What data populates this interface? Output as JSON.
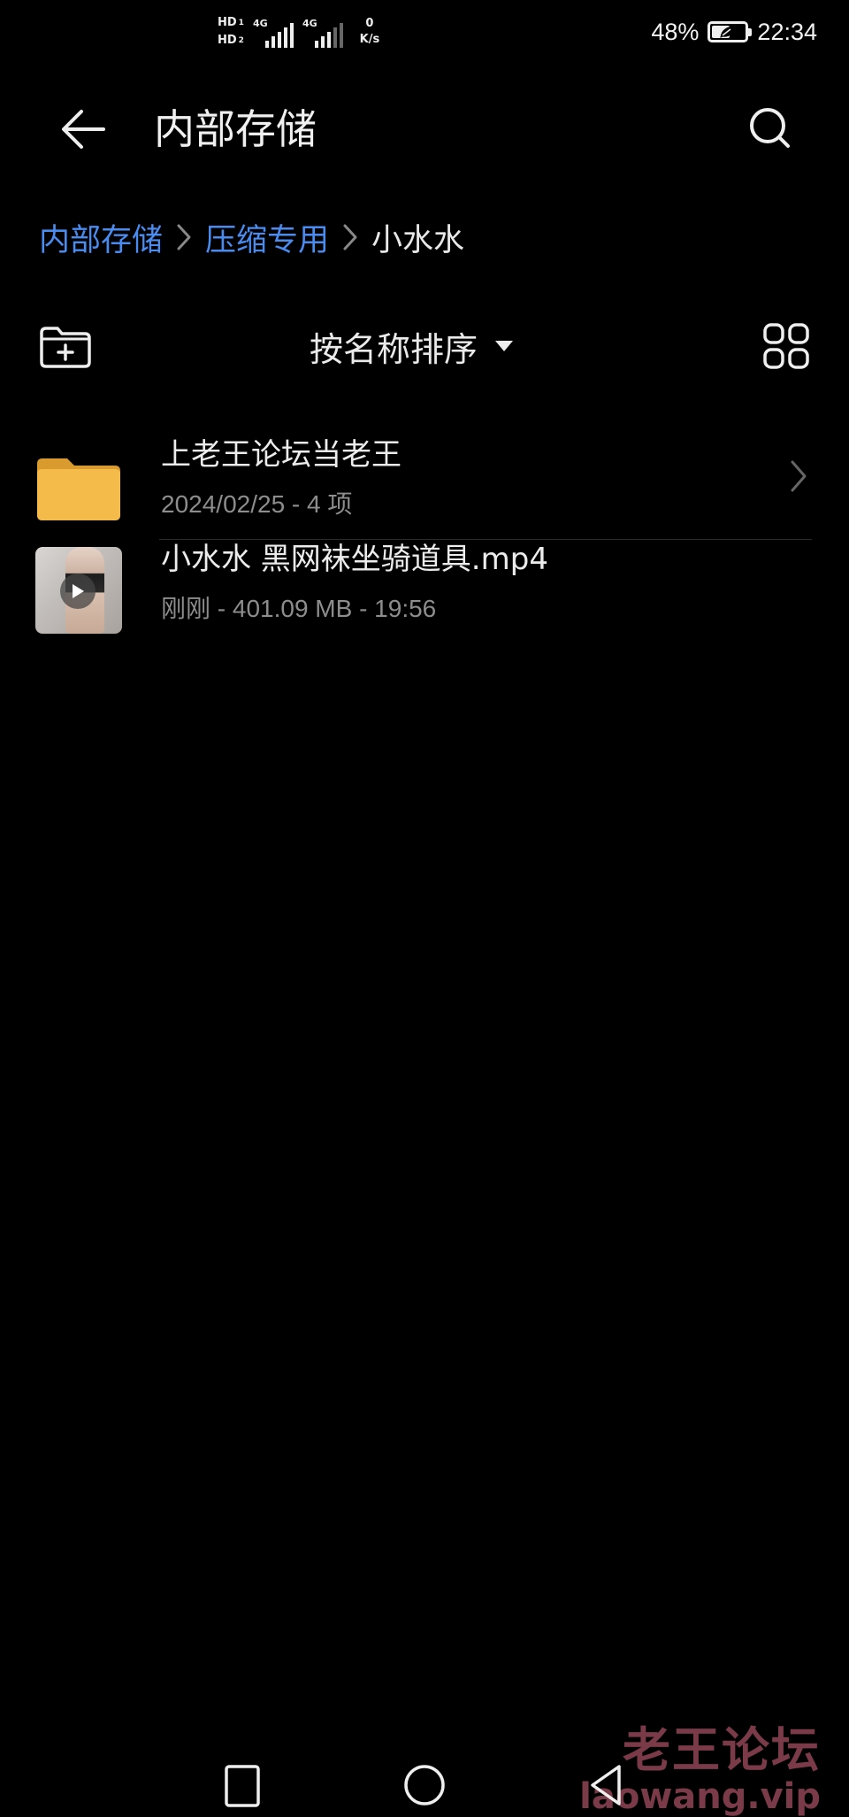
{
  "status_bar": {
    "hd1": "HD",
    "hd1_sub": "1",
    "hd2": "HD",
    "hd2_sub": "2",
    "sim1_network": "4G",
    "sim2_network": "4G",
    "speed_value": "0",
    "speed_unit": "K/s",
    "battery_percent": "48%",
    "battery_level": 0.48,
    "time": "22:34"
  },
  "header": {
    "title": "内部存储",
    "back_icon": "arrow-left-icon",
    "search_icon": "search-icon"
  },
  "breadcrumb": {
    "items": [
      {
        "label": "内部存储",
        "link": true
      },
      {
        "label": "压缩专用",
        "link": true
      },
      {
        "label": "小水水",
        "link": false
      }
    ],
    "link_color": "#4a8bf0"
  },
  "toolbar": {
    "new_folder_icon": "folder-plus-icon",
    "sort_label": "按名称排序",
    "sort_icon": "caret-down-icon",
    "view_icon": "grid-view-icon"
  },
  "files": [
    {
      "type": "folder",
      "name": "上老王论坛当老王",
      "meta": "2024/02/25 - 4 项",
      "icon": "folder-icon"
    },
    {
      "type": "video",
      "name": "小水水  黑网袜坐骑道具.mp4",
      "meta": "刚刚 - 401.09 MB - 19:56",
      "icon": "video-thumbnail"
    }
  ],
  "watermark": {
    "title": "老王论坛",
    "url": "laowang.vip"
  },
  "colors": {
    "background": "#000000",
    "folder": "#f4bb4a",
    "accent": "#4a8bf0",
    "watermark": "#7a3a48"
  }
}
